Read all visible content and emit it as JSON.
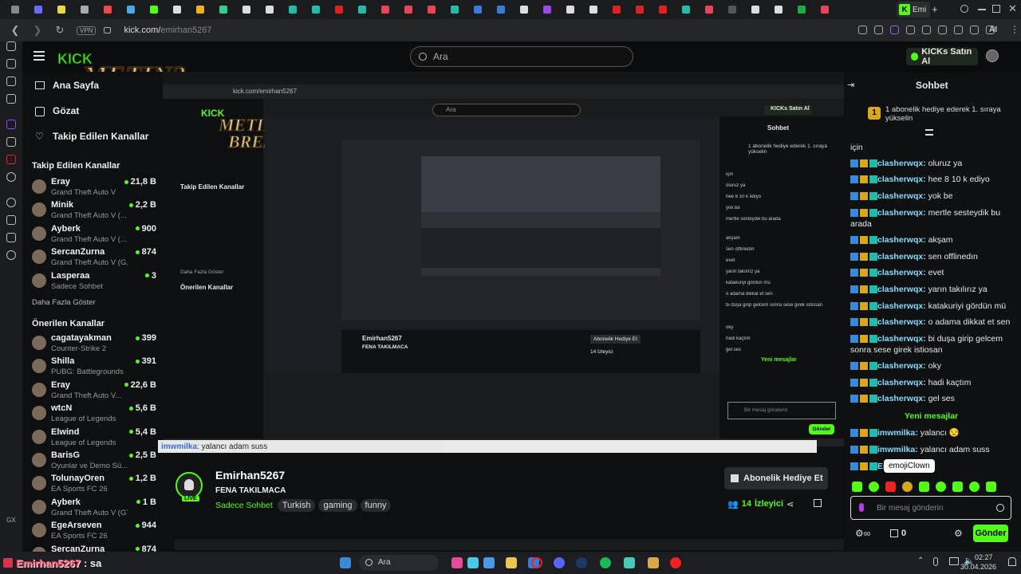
{
  "browser": {
    "tab_label": "Emi",
    "tab_add": "+",
    "vpn_label": "VPN",
    "url_domain": "kick.com/",
    "url_path": "emirhan5267",
    "ai_label": "AI"
  },
  "header": {
    "search_placeholder": "Ara",
    "kicks_button": "KICKs Satın Al"
  },
  "logo": {
    "line1": "KICK",
    "line2": "METIN2",
    "line3": "BREAK"
  },
  "sidebar": {
    "home_label": "Ana Sayfa",
    "browse_label": "Gözat",
    "following_nav": "Takip Edilen Kanallar",
    "followed_heading": "Takip Edilen Kanallar",
    "followed": [
      {
        "name": "Eray",
        "category": "Grand Theft Auto V",
        "viewers": "21,8 B"
      },
      {
        "name": "Minik",
        "category": "Grand Theft Auto V (...",
        "viewers": "2,2 B"
      },
      {
        "name": "Ayberk",
        "category": "Grand Theft Auto V (...",
        "viewers": "900"
      },
      {
        "name": "SercanZurna",
        "category": "Grand Theft Auto V (G...",
        "viewers": "874"
      },
      {
        "name": "Lasperaa",
        "category": "Sadece Sohbet",
        "viewers": "3"
      }
    ],
    "show_more": "Daha Fazla Göster",
    "recommended_heading": "Önerilen Kanallar",
    "recommended": [
      {
        "name": "cagatayakman",
        "category": "Counter-Strike 2",
        "viewers": "399"
      },
      {
        "name": "Shilla",
        "category": "PUBG: Battlegrounds",
        "viewers": "391"
      },
      {
        "name": "Eray",
        "category": "Grand Theft Auto V...",
        "viewers": "22,6 B"
      },
      {
        "name": "wtcN",
        "category": "League of Legends",
        "viewers": "5,6 B"
      },
      {
        "name": "Elwind",
        "category": "League of Legends",
        "viewers": "5,4 B"
      },
      {
        "name": "BarisG",
        "category": "Oyunlar ve Demo Sü...",
        "viewers": "2,5 B"
      },
      {
        "name": "TolunayOren",
        "category": "EA Sports FC 26",
        "viewers": "1,2 B"
      },
      {
        "name": "Ayberk",
        "category": "Grand Theft Auto V (GTA)",
        "viewers": "1 B"
      },
      {
        "name": "EgeArseven",
        "category": "EA Sports FC 26",
        "viewers": "944"
      },
      {
        "name": "SercanZurna",
        "category": "",
        "viewers": "874"
      }
    ]
  },
  "stream": {
    "channel": "Emirhan5267",
    "title": "FENA TAKILMACA",
    "category": "Sadece Sohbet",
    "tags": [
      "Turkish",
      "gaming",
      "funny"
    ],
    "live_badge": "LIVE",
    "subscribe_gift": "Abonelik Hediye Et",
    "viewers": "14",
    "viewers_label": "İzleyici"
  },
  "chat": {
    "title": "Sohbet",
    "pinned": "1 abonelik hediye ederek 1. sıraya yükselin",
    "pinned_rank": "1",
    "messages": [
      {
        "user": "",
        "text": "için"
      },
      {
        "user": "clasherwqx:",
        "text": " oluruz ya"
      },
      {
        "user": "clasherwqx:",
        "text": " hee 8 10 k ediyo"
      },
      {
        "user": "clasherwqx:",
        "text": " yok be"
      },
      {
        "user": "clasherwqx:",
        "text": " mertle sesteydik bu arada"
      },
      {
        "user": "clasherwqx:",
        "text": " akşam"
      },
      {
        "user": "clasherwqx:",
        "text": " sen offlinedın"
      },
      {
        "user": "clasherwqx:",
        "text": " evet"
      },
      {
        "user": "clasherwqx:",
        "text": " yarın takılırız ya"
      },
      {
        "user": "clasherwqx:",
        "text": " katakuriyi gördün mü"
      },
      {
        "user": "clasherwqx:",
        "text": " o adama dikkat et sen"
      },
      {
        "user": "clasherwqx:",
        "text": " bi duşa girip gelcem sonra sese girek istiosan"
      },
      {
        "user": "clasherwqx:",
        "text": " oky"
      },
      {
        "user": "clasherwqx:",
        "text": " hadi kaçtım"
      },
      {
        "user": "clasherwqx:",
        "text": " gel ses"
      }
    ],
    "new_messages": "Yeni mesajlar",
    "new_msgs": [
      {
        "user": "imwmilka:",
        "text": " yalancı 😒"
      },
      {
        "user": "imwmilka:",
        "text": " yalancı adam suss"
      },
      {
        "user": "Emirh",
        "text": ""
      }
    ],
    "tooltip": "emojiClown",
    "input_placeholder": "Bir mesaj gönderin",
    "points": "0",
    "send": "Gönder"
  },
  "overlays": {
    "inner_message_user": "imwmilka",
    "inner_message_text": ": yalancı adam suss",
    "bottom_user": "Emirhan5267",
    "bottom_text": " : sa"
  },
  "taskbar": {
    "search": "Ara",
    "time": "02:27",
    "date": "30.04.2026"
  },
  "inner": {
    "url": "kick.com/emirhan5267",
    "search": "Ara",
    "kicks": "KICKs Satın Al",
    "chat_title": "Sohbet",
    "pinned": "1 abonelik hediye ederek 1. sıraya yükselin",
    "following": "Takip Edilen Kanallar",
    "recommended": "Önerilen Kanallar",
    "more": "Daha Fazla Göster",
    "stream_channel": "Emirhan5267",
    "stream_title": "FENA TAKILMACA",
    "gift": "Abonelik Hediye Et",
    "viewers": "14 İzleyici",
    "send": "Gönder",
    "placeholder": "Bir mesaj gönderin",
    "new_messages": "Yeni mesajlar"
  },
  "colors": {
    "accent": "#53fc18",
    "bg": "#0e0f10",
    "chat_user": "#88ddff"
  }
}
